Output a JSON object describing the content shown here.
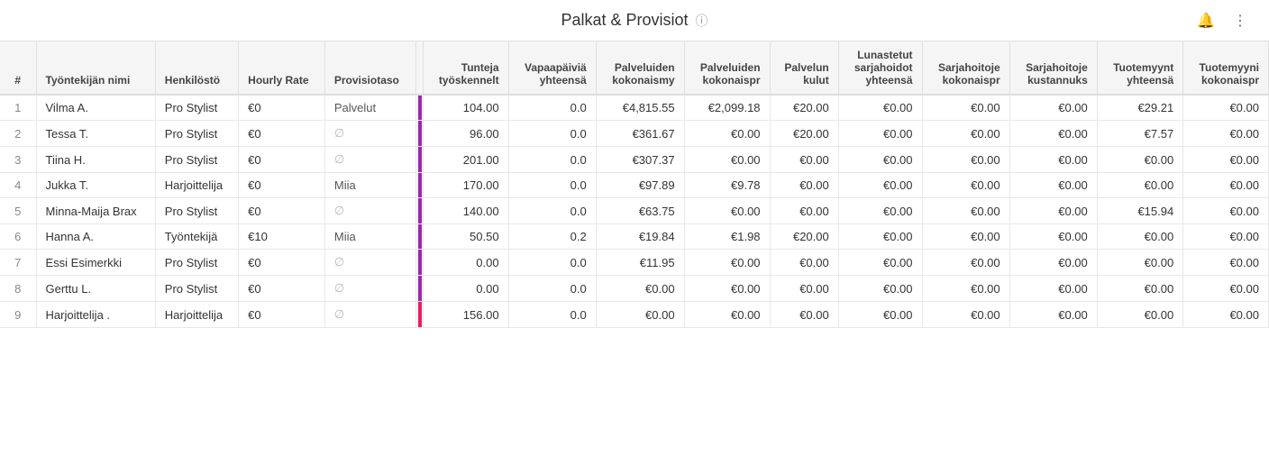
{
  "header": {
    "title": "Palkat & Provisiot",
    "info_icon": "ⓘ"
  },
  "columns": [
    {
      "key": "num",
      "label": "#",
      "type": "num"
    },
    {
      "key": "name",
      "label": "Työntekijän nimi",
      "type": "text"
    },
    {
      "key": "henkilosto",
      "label": "Henkilöstö",
      "type": "text"
    },
    {
      "key": "hourly_rate",
      "label": "Hourly Rate",
      "type": "text"
    },
    {
      "key": "provisiotas",
      "label": "Provisiotaso",
      "type": "text"
    },
    {
      "key": "bar",
      "label": "",
      "type": "bar"
    },
    {
      "key": "tunteja",
      "label": "Tunteja työskennelt",
      "type": "num"
    },
    {
      "key": "vapaapaivia",
      "label": "Vapaapäiviä yhteensä",
      "type": "num"
    },
    {
      "key": "palveluiden_kokonaismy",
      "label": "Palveluiden kokonaismy",
      "type": "num"
    },
    {
      "key": "palveluiden_kokonaispr",
      "label": "Palveluiden kokonaispr",
      "type": "num"
    },
    {
      "key": "palvelun_kulut",
      "label": "Palvelun kulut",
      "type": "num"
    },
    {
      "key": "lunastetut",
      "label": "Lunastetut sarjahoidot yhteensä",
      "type": "num"
    },
    {
      "key": "sarjahoitoje_kokonaispr",
      "label": "Sarjahoitoje kokonaispr",
      "type": "num"
    },
    {
      "key": "sarjahoitoje_kustannuks",
      "label": "Sarjahoitoje kustannuks",
      "type": "num"
    },
    {
      "key": "tuotemyynt_yhteensa",
      "label": "Tuotemyynt yhteensä",
      "type": "num"
    },
    {
      "key": "tuotemyyni_kokonaispr",
      "label": "Tuotemyyni kokonaispr",
      "type": "num"
    }
  ],
  "rows": [
    {
      "num": 1,
      "name": "Vilma A.",
      "henkilosto": "Pro Stylist",
      "hourly_rate": "€0",
      "provisiotas": "Palvelut",
      "bar_color": "purple",
      "tunteja": "104.00",
      "vapaapaivia": "0.0",
      "palveluiden_kokonaismy": "€4,815.55",
      "palveluiden_kokonaispr": "€2,099.18",
      "palvelun_kulut": "€20.00",
      "lunastetut": "€0.00",
      "sarjahoitoje_kokonaispr": "€0.00",
      "sarjahoitoje_kustannuks": "€0.00",
      "tuotemyynt_yhteensa": "€29.21",
      "tuotemyyni_kokonaispr": "€0.00"
    },
    {
      "num": 2,
      "name": "Tessa T.",
      "henkilosto": "Pro Stylist",
      "hourly_rate": "€0",
      "provisiotas": "∅",
      "bar_color": "purple",
      "tunteja": "96.00",
      "vapaapaivia": "0.0",
      "palveluiden_kokonaismy": "€361.67",
      "palveluiden_kokonaispr": "€0.00",
      "palvelun_kulut": "€20.00",
      "lunastetut": "€0.00",
      "sarjahoitoje_kokonaispr": "€0.00",
      "sarjahoitoje_kustannuks": "€0.00",
      "tuotemyynt_yhteensa": "€7.57",
      "tuotemyyni_kokonaispr": "€0.00"
    },
    {
      "num": 3,
      "name": "Tiina H.",
      "henkilosto": "Pro Stylist",
      "hourly_rate": "€0",
      "provisiotas": "∅",
      "bar_color": "purple",
      "tunteja": "201.00",
      "vapaapaivia": "0.0",
      "palveluiden_kokonaismy": "€307.37",
      "palveluiden_kokonaispr": "€0.00",
      "palvelun_kulut": "€0.00",
      "lunastetut": "€0.00",
      "sarjahoitoje_kokonaispr": "€0.00",
      "sarjahoitoje_kustannuks": "€0.00",
      "tuotemyynt_yhteensa": "€0.00",
      "tuotemyyni_kokonaispr": "€0.00"
    },
    {
      "num": 4,
      "name": "Jukka T.",
      "henkilosto": "Harjoittelija",
      "hourly_rate": "€0",
      "provisiotas": "Miia",
      "bar_color": "purple",
      "tunteja": "170.00",
      "vapaapaivia": "0.0",
      "palveluiden_kokonaismy": "€97.89",
      "palveluiden_kokonaispr": "€9.78",
      "palvelun_kulut": "€0.00",
      "lunastetut": "€0.00",
      "sarjahoitoje_kokonaispr": "€0.00",
      "sarjahoitoje_kustannuks": "€0.00",
      "tuotemyynt_yhteensa": "€0.00",
      "tuotemyyni_kokonaispr": "€0.00"
    },
    {
      "num": 5,
      "name": "Minna-Maija Brax",
      "henkilosto": "Pro Stylist",
      "hourly_rate": "€0",
      "provisiotas": "∅",
      "bar_color": "purple",
      "tunteja": "140.00",
      "vapaapaivia": "0.0",
      "palveluiden_kokonaismy": "€63.75",
      "palveluiden_kokonaispr": "€0.00",
      "palvelun_kulut": "€0.00",
      "lunastetut": "€0.00",
      "sarjahoitoje_kokonaispr": "€0.00",
      "sarjahoitoje_kustannuks": "€0.00",
      "tuotemyynt_yhteensa": "€15.94",
      "tuotemyyni_kokonaispr": "€0.00"
    },
    {
      "num": 6,
      "name": "Hanna A.",
      "henkilosto": "Työntekijä",
      "hourly_rate": "€10",
      "provisiotas": "Miia",
      "bar_color": "purple",
      "tunteja": "50.50",
      "vapaapaivia": "0.2",
      "palveluiden_kokonaismy": "€19.84",
      "palveluiden_kokonaispr": "€1.98",
      "palvelun_kulut": "€20.00",
      "lunastetut": "€0.00",
      "sarjahoitoje_kokonaispr": "€0.00",
      "sarjahoitoje_kustannuks": "€0.00",
      "tuotemyynt_yhteensa": "€0.00",
      "tuotemyyni_kokonaispr": "€0.00"
    },
    {
      "num": 7,
      "name": "Essi Esimerkki",
      "henkilosto": "Pro Stylist",
      "hourly_rate": "€0",
      "provisiotas": "∅",
      "bar_color": "purple",
      "tunteja": "0.00",
      "vapaapaivia": "0.0",
      "palveluiden_kokonaismy": "€11.95",
      "palveluiden_kokonaispr": "€0.00",
      "palvelun_kulut": "€0.00",
      "lunastetut": "€0.00",
      "sarjahoitoje_kokonaispr": "€0.00",
      "sarjahoitoje_kustannuks": "€0.00",
      "tuotemyynt_yhteensa": "€0.00",
      "tuotemyyni_kokonaispr": "€0.00"
    },
    {
      "num": 8,
      "name": "Gerttu L.",
      "henkilosto": "Pro Stylist",
      "hourly_rate": "€0",
      "provisiotas": "∅",
      "bar_color": "purple",
      "tunteja": "0.00",
      "vapaapaivia": "0.0",
      "palveluiden_kokonaismy": "€0.00",
      "palveluiden_kokonaispr": "€0.00",
      "palvelun_kulut": "€0.00",
      "lunastetut": "€0.00",
      "sarjahoitoje_kokonaispr": "€0.00",
      "sarjahoitoje_kustannuks": "€0.00",
      "tuotemyynt_yhteensa": "€0.00",
      "tuotemyyni_kokonaispr": "€0.00"
    },
    {
      "num": 9,
      "name": "Harjoittelija .",
      "henkilosto": "Harjoittelija",
      "hourly_rate": "€0",
      "provisiotas": "∅",
      "bar_color": "pink",
      "tunteja": "156.00",
      "vapaapaivia": "0.0",
      "palveluiden_kokonaismy": "€0.00",
      "palveluiden_kokonaispr": "€0.00",
      "palvelun_kulut": "€0.00",
      "lunastetut": "€0.00",
      "sarjahoitoje_kokonaispr": "€0.00",
      "sarjahoitoje_kustannuks": "€0.00",
      "tuotemyynt_yhteensa": "€0.00",
      "tuotemyyni_kokonaispr": "€0.00"
    }
  ],
  "icons": {
    "bell": "🔔",
    "menu": "⋮",
    "info": "ⓘ"
  }
}
